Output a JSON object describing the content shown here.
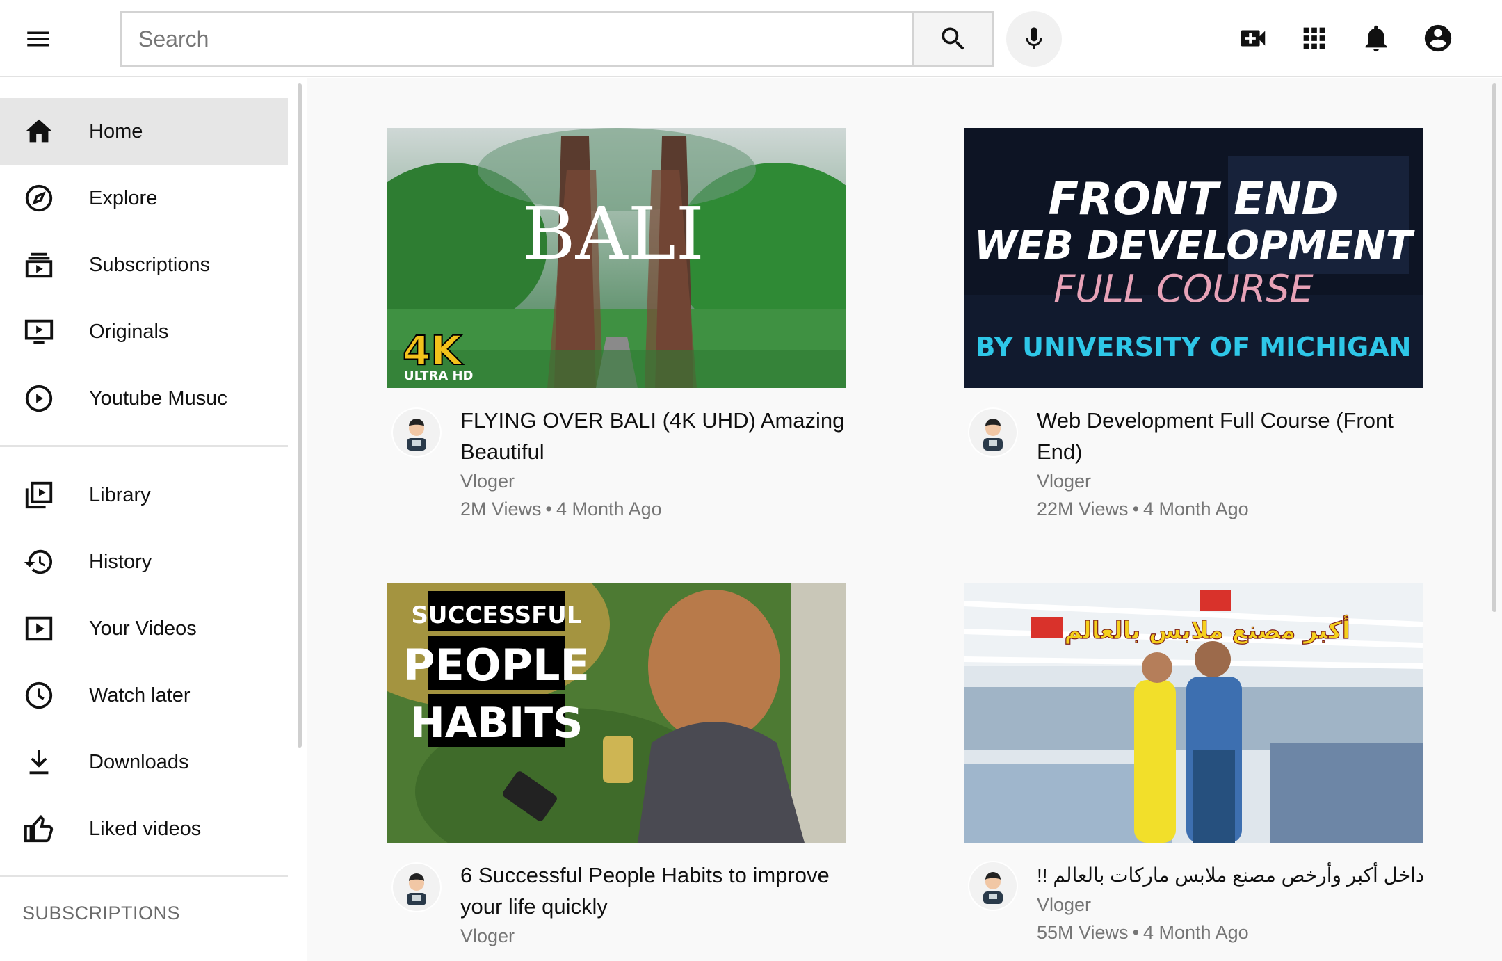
{
  "header": {
    "search_placeholder": "Search",
    "icons": [
      "menu-icon",
      "search-icon",
      "mic-icon",
      "video-add-icon",
      "apps-grid-icon",
      "bell-icon",
      "account-icon"
    ]
  },
  "sidebar": {
    "primary": [
      {
        "label": "Home",
        "icon": "home-icon",
        "active": true
      },
      {
        "label": "Explore",
        "icon": "compass-icon"
      },
      {
        "label": "Subscriptions",
        "icon": "subscriptions-icon"
      },
      {
        "label": "Originals",
        "icon": "originals-icon"
      },
      {
        "label": "Youtube Musuc",
        "icon": "music-play-icon"
      }
    ],
    "secondary": [
      {
        "label": "Library",
        "icon": "library-icon"
      },
      {
        "label": "History",
        "icon": "history-icon"
      },
      {
        "label": "Your Videos",
        "icon": "your-videos-icon"
      },
      {
        "label": "Watch later",
        "icon": "clock-icon"
      },
      {
        "label": "Downloads",
        "icon": "download-icon"
      },
      {
        "label": "Liked videos",
        "icon": "thumbs-up-icon"
      }
    ],
    "section_heading": "SUBSCRIPTIONS"
  },
  "videos": [
    {
      "title": "FLYING OVER BALI (4K UHD) Amazing Beautiful",
      "channel": "Vloger",
      "views": "2M Views",
      "age": "4 Month Ago",
      "thumb": {
        "text_main": "BALI",
        "text_4k": "4K",
        "text_uhd": "ULTRA HD"
      }
    },
    {
      "title": "Web Development Full Course (Front End)",
      "channel": "Vloger",
      "views": "22M Views",
      "age": "4 Month Ago",
      "thumb": {
        "line1": "FRONT END",
        "line2": "WEB DEVELOPMENT",
        "line3": "FULL COURSE",
        "line4": "BY UNIVERSITY OF MICHIGAN"
      }
    },
    {
      "title": "6 Successful People Habits to improve your life quickly",
      "channel": "Vloger",
      "thumb": {
        "line1": "SUCCESSFUL",
        "line2": "PEOPLE",
        "line3": "HABITS"
      }
    },
    {
      "title": "داخل أكبر وأرخص مصنع ملابس ماركات بالعالم !!",
      "channel": "Vloger",
      "views": "55M Views",
      "age": "4 Month Ago",
      "thumb": {
        "banner": "أكبر مصنع ملابس بالعالم"
      }
    }
  ],
  "colors": {
    "accent_active_bg": "#e6e6e6",
    "text_secondary": "#757575",
    "main_bg": "#f9f9f9"
  }
}
